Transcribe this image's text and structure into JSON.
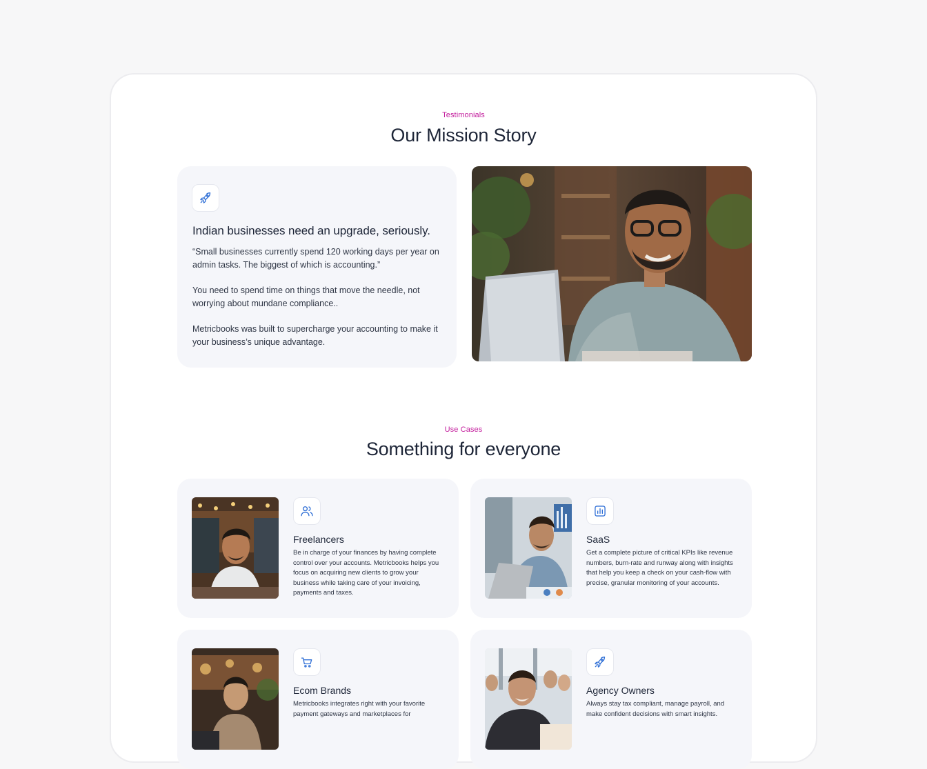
{
  "testimonials": {
    "eyebrow": "Testimonials",
    "heading": "Our Mission Story",
    "card": {
      "icon": "rocket-icon",
      "title": "Indian businesses need an upgrade, seriously.",
      "quote": "“Small businesses currently spend 120 working days per year on admin tasks. The biggest of which is accounting.”",
      "paragraph_2": "You need to spend time on things that move the needle, not worrying about mundane compliance..",
      "paragraph_3": "Metricbooks was built to supercharge your accounting to make it your business’s unique advantage."
    }
  },
  "use_cases": {
    "eyebrow": "Use Cases",
    "heading": "Something for everyone",
    "cards": [
      {
        "icon": "users-icon",
        "title": "Freelancers",
        "description": "Be in charge of your finances by having complete control over your accounts. Metricbooks helps you focus on acquiring new clients to grow your business while taking care of your invoicing, payments and taxes."
      },
      {
        "icon": "chart-icon",
        "title": "SaaS",
        "description": "Get a complete picture of critical KPIs like revenue numbers, burn-rate and runway along with insights that help you keep a check on your cash-flow with precise, granular monitoring of your accounts."
      },
      {
        "icon": "cart-icon",
        "title": "Ecom Brands",
        "description": "Metricbooks integrates right with your favorite payment gateways and marketplaces for"
      },
      {
        "icon": "rocket-icon",
        "title": "Agency Owners",
        "description": "Always stay tax compliant, manage payroll, and make confident decisions with smart insights."
      }
    ]
  },
  "colors": {
    "accent": "#c21a9b",
    "icon_blue": "#2f6fd6",
    "heading": "#1d2537",
    "card_bg": "#f5f6fa"
  }
}
